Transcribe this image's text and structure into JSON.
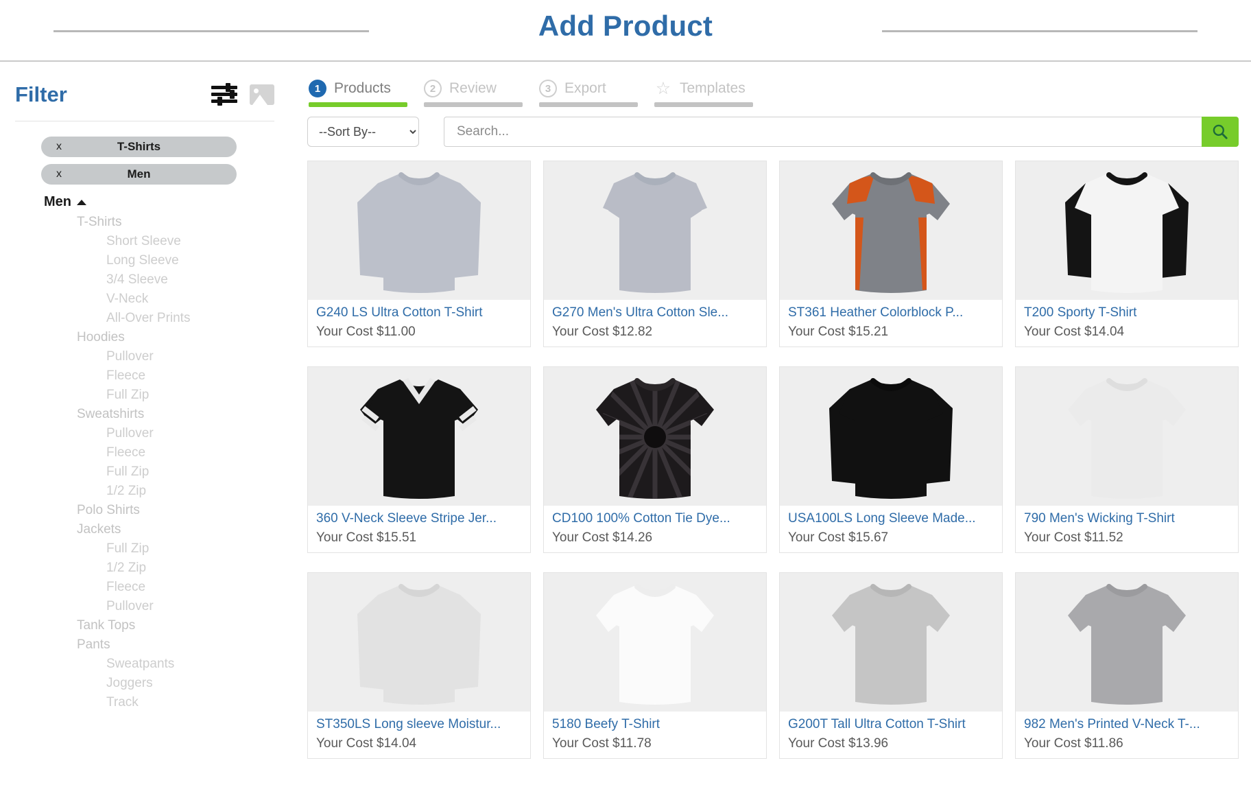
{
  "header": {
    "title": "Add Product"
  },
  "sidebar": {
    "filter_title": "Filter",
    "icons": {
      "sliders": "sliders-icon",
      "image": "image-icon"
    },
    "chips": [
      {
        "remove": "x",
        "label": "T-Shirts"
      },
      {
        "remove": "x",
        "label": "Men"
      }
    ],
    "tree_root": "Men",
    "tree": [
      {
        "level": 1,
        "label": "T-Shirts"
      },
      {
        "level": 2,
        "label": "Short Sleeve"
      },
      {
        "level": 2,
        "label": "Long Sleeve"
      },
      {
        "level": 2,
        "label": "3/4 Sleeve"
      },
      {
        "level": 2,
        "label": "V-Neck"
      },
      {
        "level": 2,
        "label": "All-Over Prints"
      },
      {
        "level": 1,
        "label": "Hoodies"
      },
      {
        "level": 2,
        "label": "Pullover"
      },
      {
        "level": 2,
        "label": "Fleece"
      },
      {
        "level": 2,
        "label": "Full Zip"
      },
      {
        "level": 1,
        "label": "Sweatshirts"
      },
      {
        "level": 2,
        "label": "Pullover"
      },
      {
        "level": 2,
        "label": "Fleece"
      },
      {
        "level": 2,
        "label": "Full Zip"
      },
      {
        "level": 2,
        "label": "1/2 Zip"
      },
      {
        "level": 1,
        "label": "Polo Shirts"
      },
      {
        "level": 1,
        "label": "Jackets"
      },
      {
        "level": 2,
        "label": "Full Zip"
      },
      {
        "level": 2,
        "label": "1/2 Zip"
      },
      {
        "level": 2,
        "label": "Fleece"
      },
      {
        "level": 2,
        "label": "Pullover"
      },
      {
        "level": 1,
        "label": "Tank Tops"
      },
      {
        "level": 1,
        "label": "Pants"
      },
      {
        "level": 2,
        "label": "Sweatpants"
      },
      {
        "level": 2,
        "label": "Joggers"
      },
      {
        "level": 2,
        "label": "Track"
      }
    ]
  },
  "tabs": [
    {
      "num": "1",
      "label": "Products",
      "active": true
    },
    {
      "num": "2",
      "label": "Review",
      "active": false
    },
    {
      "num": "3",
      "label": "Export",
      "active": false
    },
    {
      "num": "star",
      "label": "Templates",
      "active": false
    }
  ],
  "controls": {
    "sort_selected": "--Sort By--",
    "sort_options": [
      "--Sort By--"
    ],
    "search_placeholder": "Search...",
    "search_value": "",
    "search_button_icon": "search-icon"
  },
  "colors": {
    "brand_blue": "#2f6ca8",
    "tab_blue": "#1f69b0",
    "accent_green": "#77cc2b",
    "chip_gray": "#c6c9cb",
    "muted_text": "#c2c2c2"
  },
  "cost_prefix": "Your Cost",
  "products": [
    {
      "title": "G240 LS Ultra Cotton T-Shirt",
      "cost": "Your Cost $11.00",
      "style": "long-sleeve-gray"
    },
    {
      "title": "G270 Men's Ultra Cotton Sle...",
      "cost": "Your Cost $12.82",
      "style": "sleeveless-gray"
    },
    {
      "title": "ST361 Heather Colorblock P...",
      "cost": "Your Cost $15.21",
      "style": "colorblock-orange"
    },
    {
      "title": "T200 Sporty T-Shirt",
      "cost": "Your Cost $14.04",
      "style": "raglan-black"
    },
    {
      "title": "360 V-Neck Sleeve Stripe Jer...",
      "cost": "Your Cost $15.51",
      "style": "vneck-stripe"
    },
    {
      "title": "CD100 100% Cotton Tie Dye...",
      "cost": "Your Cost $14.26",
      "style": "tiedye-black"
    },
    {
      "title": "USA100LS Long Sleeve Made...",
      "cost": "Your Cost $15.67",
      "style": "long-sleeve-black"
    },
    {
      "title": "790 Men's Wicking T-Shirt",
      "cost": "Your Cost $11.52",
      "style": "tee-white"
    },
    {
      "title": "ST350LS Long sleeve Moistur...",
      "cost": "Your Cost $14.04",
      "style": "long-sleeve-white"
    },
    {
      "title": "5180 Beefy T-Shirt",
      "cost": "Your Cost $11.78",
      "style": "tee-bright-white"
    },
    {
      "title": "G200T Tall Ultra Cotton T-Shirt",
      "cost": "Your Cost $13.96",
      "style": "tee-lightgray"
    },
    {
      "title": "982 Men's Printed V-Neck T-...",
      "cost": "Your Cost $11.86",
      "style": "tee-heather"
    }
  ]
}
